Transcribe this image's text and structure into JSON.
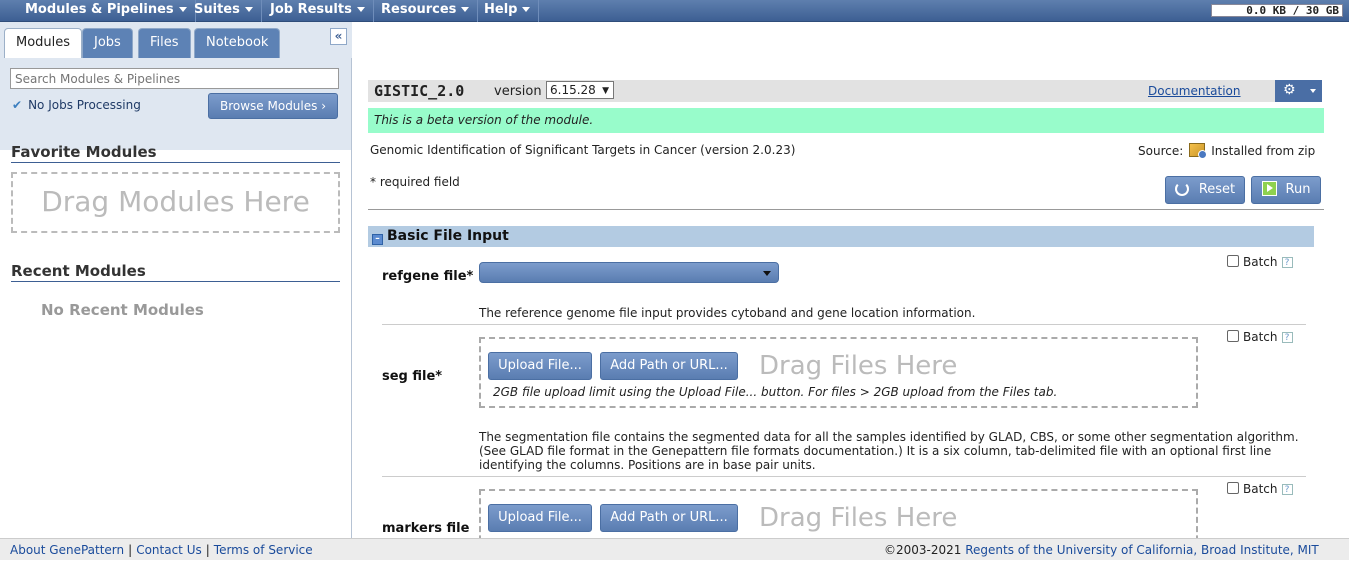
{
  "topnav": {
    "menus": [
      "Modules & Pipelines",
      "Suites",
      "Job Results",
      "Resources",
      "Help"
    ],
    "quota": "0.0 KB / 30 GB"
  },
  "sidebar": {
    "tabs": [
      "Modules",
      "Jobs",
      "Files",
      "Notebook"
    ],
    "active_tab": "Modules",
    "collapse_glyph": "«",
    "search_placeholder": "Search Modules & Pipelines",
    "jobs_status": "No Jobs Processing",
    "browse_label": "Browse Modules ›",
    "favorites_title": "Favorite Modules",
    "favorites_drop": "Drag Modules Here",
    "recent_title": "Recent Modules",
    "recent_empty": "No Recent Modules"
  },
  "module": {
    "name": "GISTIC_2.0",
    "version_label": "version",
    "version": "6.15.28",
    "documentation": "Documentation",
    "beta_notice": "This is a beta version of the module.",
    "description": "Genomic Identification of Significant Targets in Cancer (version 2.0.23)",
    "source_label": "Source:",
    "source_value": "Installed from zip",
    "required_note": "* required field",
    "reset_label": "Reset",
    "run_label": "Run",
    "accent_color": "#98fccb"
  },
  "group": {
    "title": "Basic File Input"
  },
  "params": [
    {
      "label": "refgene file*",
      "batch": "Batch",
      "description": "The reference genome file input provides cytoband and gene location information."
    },
    {
      "label": "seg file*",
      "batch": "Batch",
      "upload": "Upload File...",
      "addpath": "Add Path or URL...",
      "drop": "Drag Files Here",
      "limit": "2GB file upload limit using the Upload File... button. For files > 2GB upload from the Files tab.",
      "description_lines": [
        "The segmentation file contains the segmented data for all the samples identified by GLAD, CBS, or some other segmentation algorithm.",
        "(See GLAD file format in the Genepattern file formats documentation.) It is a six column, tab-delimited file with an optional first line",
        "identifying the columns. Positions are in base pair units."
      ]
    },
    {
      "label": "markers file",
      "batch": "Batch",
      "upload": "Upload File...",
      "addpath": "Add Path or URL...",
      "drop": "Drag Files Here"
    }
  ],
  "footer": {
    "about": "About GenePattern",
    "contact": "Contact Us",
    "terms": "Terms of Service",
    "copyright": "©2003-2021",
    "regents": "Regents of the University of California, Broad Institute, MIT"
  }
}
